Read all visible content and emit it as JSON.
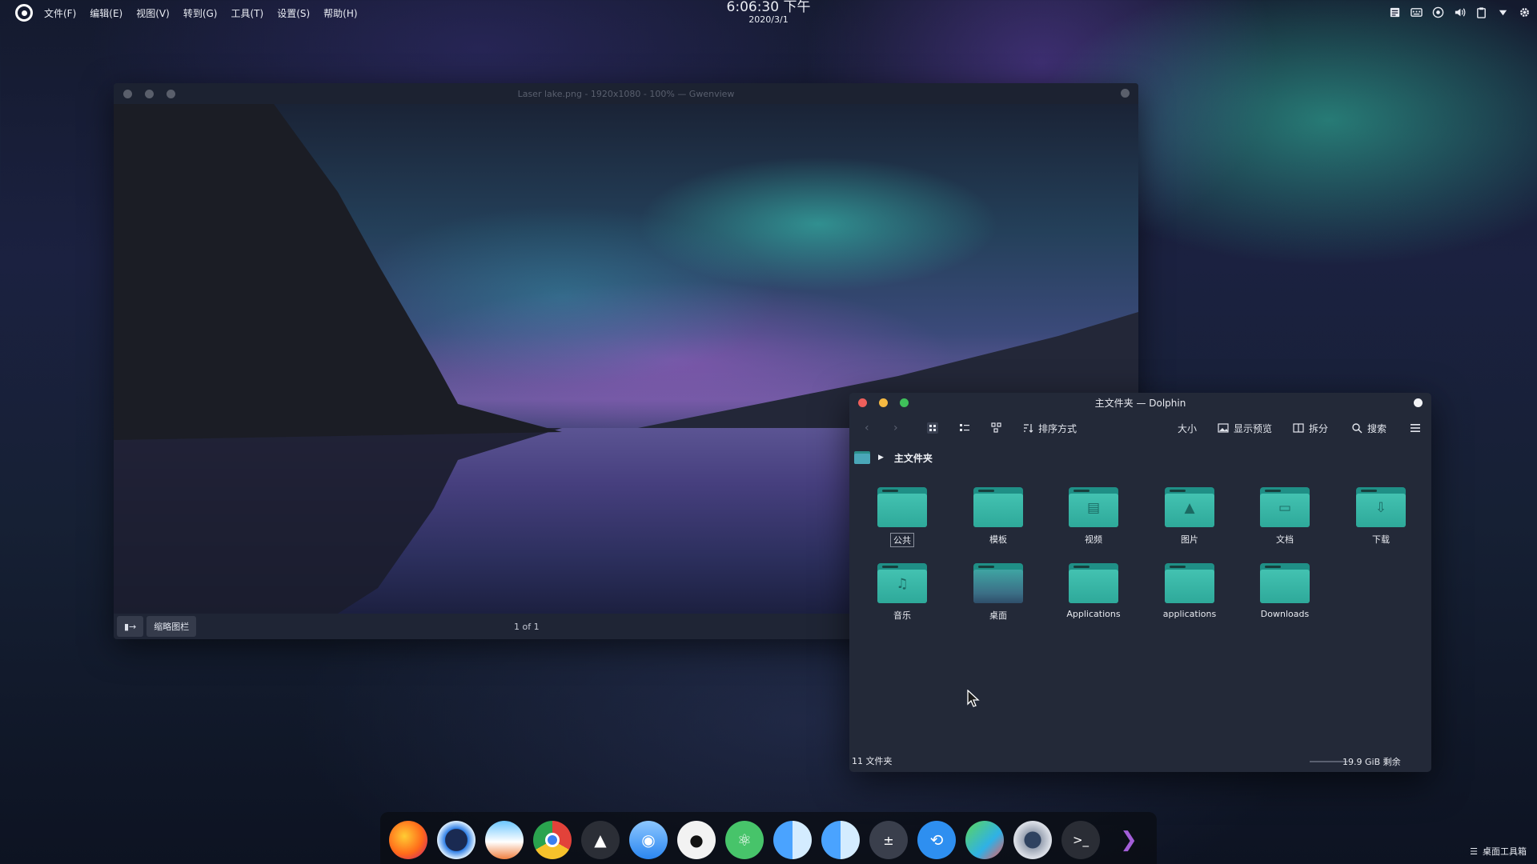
{
  "top_panel": {
    "menu": [
      "文件(F)",
      "编辑(E)",
      "视图(V)",
      "转到(G)",
      "工具(T)",
      "设置(S)",
      "帮助(H)"
    ],
    "time": "6:06:30 下午",
    "date": "2020/3/1",
    "tray_icons": [
      "notes-icon",
      "keyboard-icon",
      "network-icon",
      "volume-icon",
      "clipboard-icon",
      "expand-arrow-icon",
      "settings-icon"
    ]
  },
  "gwenview": {
    "title": "Laser lake.png - 1920x1080 - 100% — Gwenview",
    "thumbnail_bar_label": "缩略图栏",
    "page_counter": "1 of 1"
  },
  "dolphin": {
    "title": "主文件夹 — Dolphin",
    "toolbar": {
      "sort_label": "排序方式",
      "size_label": "大小",
      "preview_label": "显示预览",
      "split_label": "拆分",
      "search_label": "搜索"
    },
    "breadcrumb": "主文件夹",
    "folders": [
      {
        "name": "公共",
        "glyph": ""
      },
      {
        "name": "模板",
        "glyph": ""
      },
      {
        "name": "视频",
        "glyph": "▤"
      },
      {
        "name": "图片",
        "glyph": "▲"
      },
      {
        "name": "文档",
        "glyph": "▭"
      },
      {
        "name": "下载",
        "glyph": "⇩"
      },
      {
        "name": "音乐",
        "glyph": "♫"
      },
      {
        "name": "桌面",
        "glyph": ""
      },
      {
        "name": "Applications",
        "glyph": ""
      },
      {
        "name": "applications",
        "glyph": ""
      },
      {
        "name": "Downloads",
        "glyph": ""
      }
    ],
    "status_count": "11 文件夹",
    "status_free": "19.9 GiB 剩余",
    "traffic_colors": [
      "#ee5f5b",
      "#f5b942",
      "#3fc05a"
    ]
  },
  "dock": {
    "apps": [
      "firefox",
      "safari-browser",
      "wallpaper-app",
      "chrome",
      "inkscape",
      "qq",
      "github-desktop",
      "atom",
      "finder",
      "finder-2",
      "calculator",
      "sync-app",
      "maps-app",
      "disk-utility",
      "terminal",
      "visual-studio"
    ],
    "toolbox_label": "桌面工具箱"
  }
}
